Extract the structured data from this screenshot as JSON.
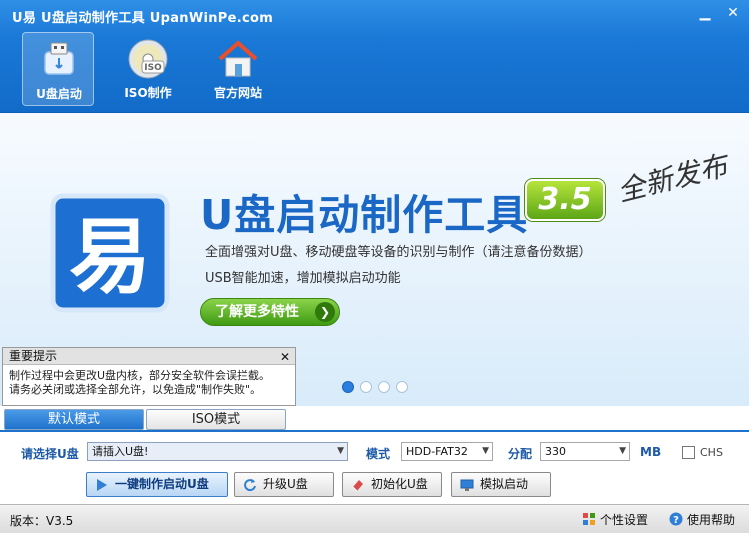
{
  "window": {
    "title": "U易  U盘启动制作工具  UpanWinPe.com",
    "minimize_icon": "minimize-icon",
    "close_icon": "close-icon"
  },
  "toolbar": {
    "items": [
      {
        "label": "U盘启动",
        "icon": "usb-drive-icon",
        "active": true
      },
      {
        "label": "ISO制作",
        "icon": "disc-iso-icon",
        "active": false
      },
      {
        "label": "官方网站",
        "icon": "home-icon",
        "active": false
      }
    ]
  },
  "banner": {
    "logo_char": "易",
    "headline": "U盘启动制作工具",
    "version_badge": "3.5",
    "new_release": "全新发布",
    "desc1": "全面增强对U盘、移动硬盘等设备的识别与制作（请注意备份数据）",
    "desc2": "USB智能加速，增加模拟启动功能",
    "more_button": "了解更多特性",
    "more_arrow": "❯",
    "carousel_active": 0
  },
  "notice": {
    "title": "重要提示",
    "close": "✕",
    "body1": "制作过程中会更改U盘内核，部分安全软件会误拦截。",
    "body2": "请务必关闭或选择全部允许，以免造成\"制作失败\"。"
  },
  "tabs": [
    {
      "label": "默认模式",
      "active": true
    },
    {
      "label": "ISO模式",
      "active": false
    }
  ],
  "form": {
    "drive_label": "请选择U盘",
    "drive_value": "请插入U盘!",
    "mode_label": "模式",
    "mode_value": "HDD-FAT32",
    "alloc_label": "分配",
    "alloc_value": "330",
    "alloc_unit": "MB",
    "chs_label": "CHS",
    "chs_checked": false,
    "caret": "▼"
  },
  "buttons": {
    "oneclick": "一键制作启动U盘",
    "upgrade": "升级U盘",
    "init": "初始化U盘",
    "simulate": "模拟启动"
  },
  "status": {
    "version": "版本：V3.5",
    "personalize": "个性设置",
    "help": "使用帮助"
  },
  "colors": {
    "title_bar": "#1a78d6",
    "accent": "#1f72cc",
    "headline": "#1a67c6",
    "green": "#5ca617"
  }
}
